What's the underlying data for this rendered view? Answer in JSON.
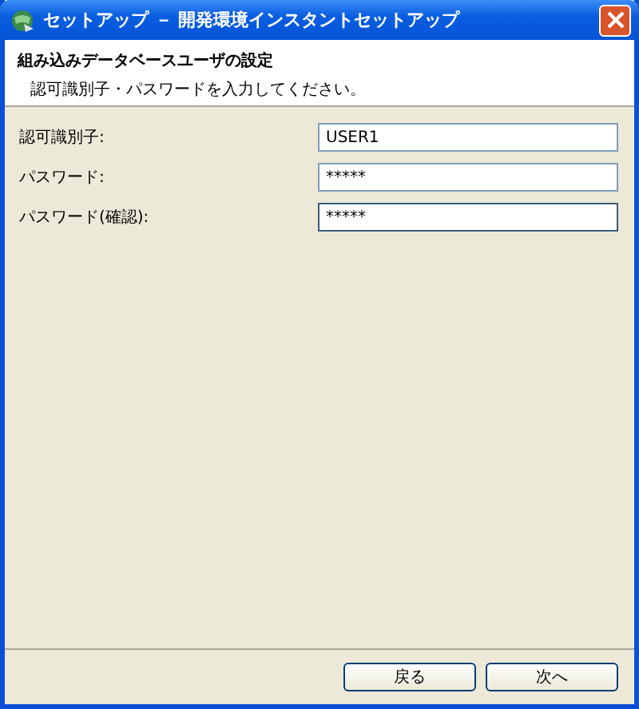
{
  "window": {
    "title": "セットアップ － 開発環境インスタントセットアップ"
  },
  "header": {
    "title": "組み込みデータベースユーザの設定",
    "subtitle": "認可識別子・パスワードを入力してください。"
  },
  "fields": [
    {
      "label": "認可識別子:",
      "value": "USER1",
      "focused": false
    },
    {
      "label": "パスワード:",
      "value": "*****",
      "focused": false
    },
    {
      "label": "パスワード(確認):",
      "value": "*****",
      "focused": true
    }
  ],
  "buttons": [
    "戻る",
    "次へ"
  ]
}
